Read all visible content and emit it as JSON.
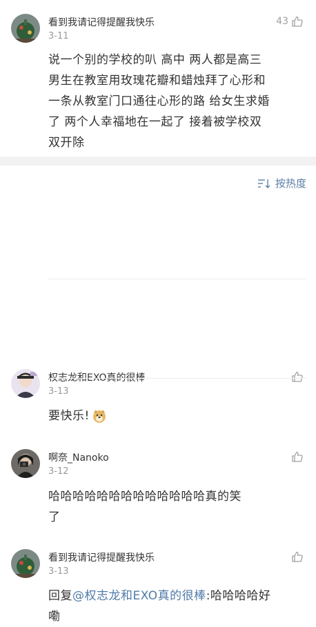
{
  "post": {
    "username": "看到我请记得提醒我快乐",
    "date": "3-11",
    "likes": "43",
    "lines": [
      "说一个别的学校的叭  高中  两人都是高三",
      "男生在教室用玫瑰花瓣和蜡烛拜了心形和",
      "一条从教室门口通往心形的路  给女生求婚",
      "了  两个人幸福地在一起了  接着被学校双",
      "双开除"
    ]
  },
  "sort": {
    "label": "按热度",
    "icon": "sort-icon"
  },
  "comments": [
    {
      "username": "权志龙和EXO真的很棒",
      "date": "3-13",
      "text": "要快乐!",
      "emoji": "doge-emoji"
    },
    {
      "username": "啊奈_Nanoko",
      "date": "3-12",
      "lines": [
        "哈哈哈哈哈哈哈哈哈哈哈哈哈真的笑",
        "了"
      ]
    },
    {
      "username": "看到我请记得提醒我快乐",
      "date": "3-13",
      "reply_prefix": "回复",
      "mention": "@权志龙和EXO真的很棒",
      "line1_rest": ":哈哈哈哈好",
      "line2": "嘞"
    }
  ],
  "colors": {
    "link": "#4f7aa8",
    "meta": "#9a9a9a",
    "band": "#f2f2f2"
  }
}
